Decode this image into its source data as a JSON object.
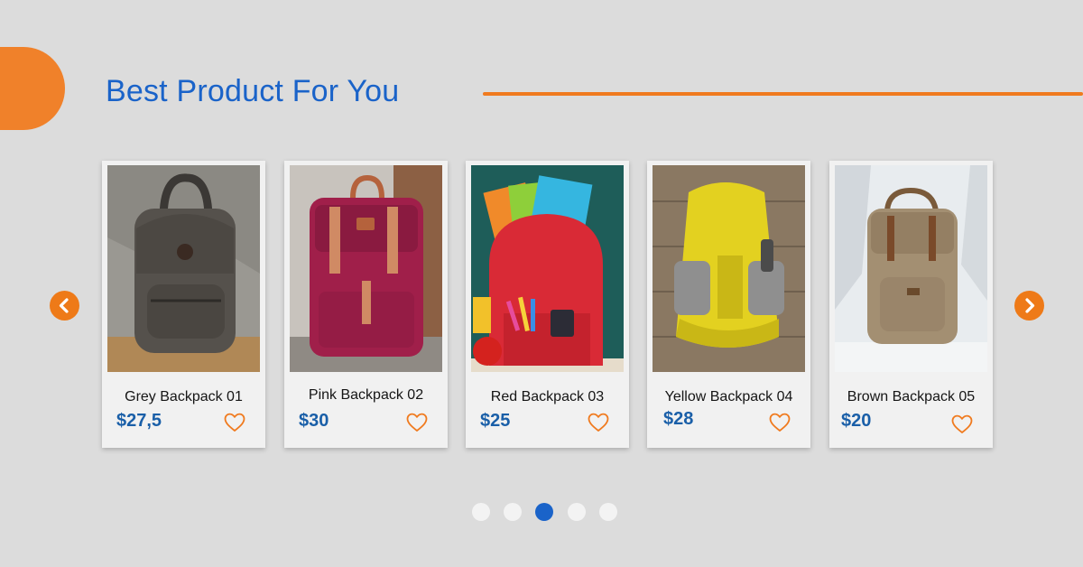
{
  "header": {
    "title": "Best Product For You"
  },
  "colors": {
    "accent": "#f07a1e",
    "title": "#1a63c9",
    "price": "#1a5fa8",
    "background": "#dcdcdc"
  },
  "carousel": {
    "prev_icon": "chevron-left-icon",
    "next_icon": "chevron-right-icon",
    "products": [
      {
        "name": "Grey Backpack 01",
        "price": "$27,5",
        "color": "#5a5650"
      },
      {
        "name": "Pink Backpack 02",
        "price": "$30",
        "color": "#a01f4a"
      },
      {
        "name": "Red Backpack 03",
        "price": "$25",
        "color": "#d92a36"
      },
      {
        "name": "Yellow Backpack 04",
        "price": "$28",
        "color": "#e3d120"
      },
      {
        "name": "Brown Backpack 05",
        "price": "$20",
        "color": "#a38f72"
      }
    ],
    "favorite_icon": "heart-outline-icon",
    "pagination": {
      "count": 5,
      "active_index": 3
    }
  }
}
